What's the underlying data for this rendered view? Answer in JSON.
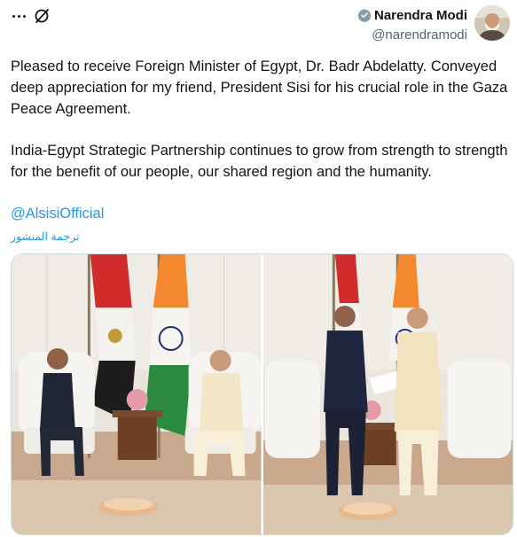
{
  "post": {
    "author": {
      "display_name": "Narendra Modi",
      "handle": "@narendramodi"
    },
    "paragraphs": [
      "Pleased to receive Foreign Minister of Egypt, Dr. Badr Abdelatty. Conveyed deep appreciation for my friend, President Sisi for his crucial role in the Gaza Peace Agreement.",
      "India-Egypt Strategic Partnership continues to grow from strength to strength for the benefit of our people, our shared region and the humanity."
    ],
    "mention": "@AlsisiOfficial",
    "translate_label": "ترجمة المنشور"
  },
  "icons": {
    "more": "more-icon",
    "grok": "grok-icon",
    "verified": "verified-badge-icon"
  },
  "colors": {
    "link": "#1d9bf0",
    "text": "#0f1419",
    "secondary": "#536471",
    "verified_badge": "#829aab",
    "border": "#cfd9de"
  }
}
